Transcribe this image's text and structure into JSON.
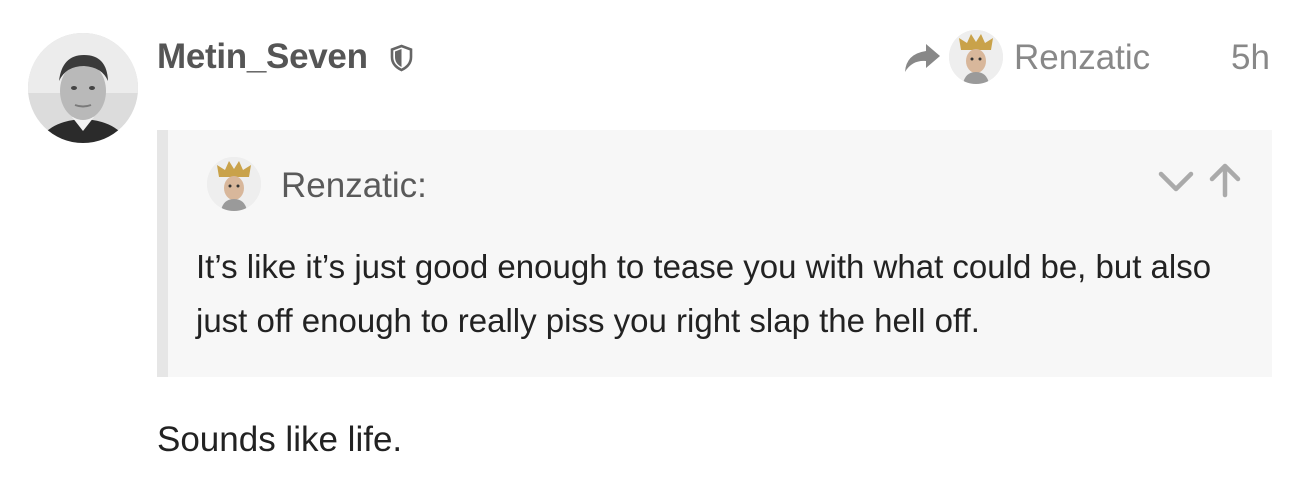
{
  "post": {
    "username": "Metin_Seven",
    "badge_icon": "shield-icon",
    "reply_to": {
      "icon": "reply-arrow-icon",
      "name": "Renzatic"
    },
    "date": "5h",
    "quote": {
      "author": "Renzatic:",
      "text": "It’s like it’s just good enough to tease you with what could be, but also just off enough to really piss you right slap the hell off.",
      "expand_icon": "chevron-down-icon",
      "jump_icon": "arrow-up-icon"
    },
    "body": "Sounds like life."
  },
  "colors": {
    "username": "#555555",
    "meta": "#888888",
    "quote_bg": "#f7f7f7",
    "quote_border": "#e6e6e6",
    "text": "#222222"
  }
}
